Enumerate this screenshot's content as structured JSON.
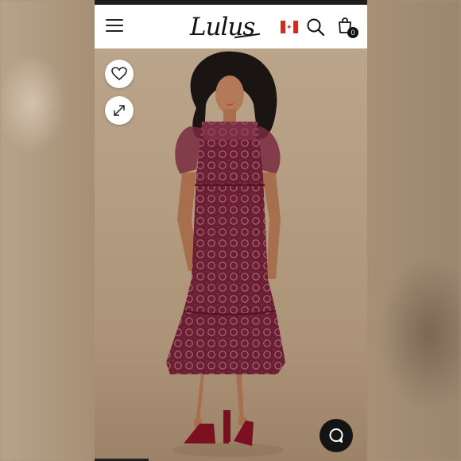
{
  "header": {
    "logo_text": "Lulus",
    "menu_icon": "hamburger-menu-icon",
    "flag_icon": "canada-flag-icon",
    "search_icon": "search-icon",
    "bag_icon": "shopping-bag-icon",
    "bag_count": "0"
  },
  "product_image": {
    "favorite_icon": "heart-icon",
    "expand_icon": "expand-icon",
    "dress_color": "#6b1f33"
  },
  "chat": {
    "icon": "chat-bubble-icon"
  }
}
